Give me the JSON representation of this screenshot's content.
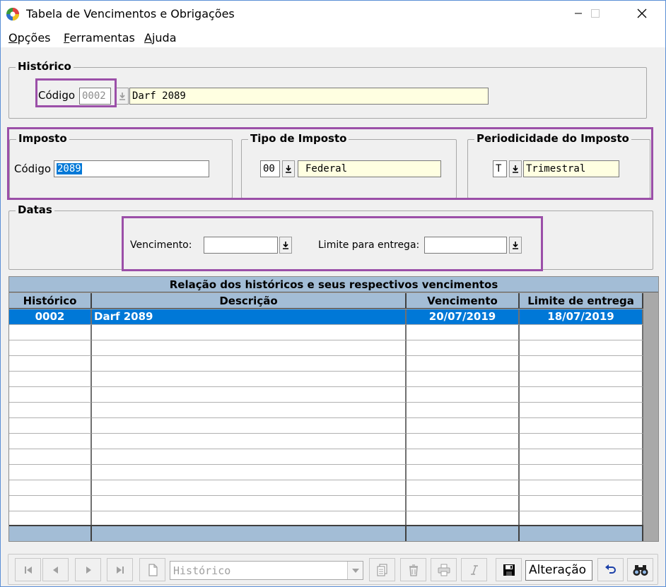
{
  "window": {
    "title": "Tabela de Vencimentos e Obrigações"
  },
  "menu": [
    {
      "label": "Opções",
      "accel": "O",
      "rest": "pções"
    },
    {
      "label": "Ferramentas",
      "accel": "F",
      "rest": "erramentas"
    },
    {
      "label": "Ajuda",
      "accel": "A",
      "rest": "juda"
    }
  ],
  "historico": {
    "legend": "Histórico",
    "codigo_label": "Código",
    "codigo_value": "0002",
    "descricao_value": "Darf 2089"
  },
  "imposto": {
    "legend": "Imposto",
    "codigo_label": "Código",
    "codigo_value": "2089"
  },
  "tipo_imposto": {
    "legend": "Tipo de Imposto",
    "code_value": "00",
    "name_value": "Federal"
  },
  "periodicidade": {
    "legend": "Periodicidade do  Imposto",
    "code_value": "T",
    "name_value": "Trimestral"
  },
  "datas": {
    "legend": "Datas",
    "vencimento_label": "Vencimento:",
    "vencimento_value": "",
    "limite_label": "Limite para entrega:",
    "limite_value": ""
  },
  "grid": {
    "caption": "Relação dos históricos e seus respectivos vencimentos",
    "columns": [
      "Histórico",
      "Descrição",
      "Vencimento",
      "Limite de entrega"
    ],
    "rows": [
      {
        "historico": "0002",
        "descricao": "Darf 2089",
        "vencimento": "20/07/2019",
        "limite": "18/07/2019"
      }
    ],
    "selected_row": 0
  },
  "toolbar": {
    "combo_value": "Histórico",
    "mode_value": "Alteração"
  },
  "colors": {
    "highlight_box": "#9b4fa8",
    "selection": "#0078d7",
    "grid_header": "#a3bdd6",
    "readonly_field": "#ffffe1"
  },
  "icons": [
    "app-icon",
    "minimize-icon",
    "maximize-icon",
    "close-icon",
    "dropdown-arrow-icon",
    "first-record-icon",
    "previous-record-icon",
    "next-record-icon",
    "last-record-icon",
    "new-document-icon",
    "copy-icon",
    "delete-icon",
    "print-icon",
    "italic-icon",
    "save-icon",
    "undo-icon",
    "binoculars-icon"
  ]
}
